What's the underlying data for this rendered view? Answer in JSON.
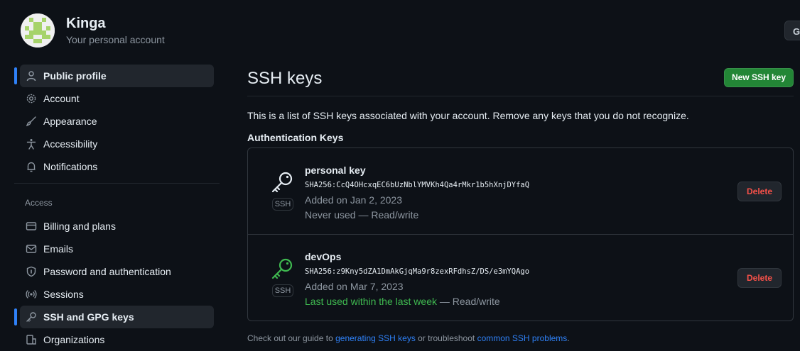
{
  "account": {
    "name": "Kinga",
    "subtitle": "Your personal account",
    "go_button_label": "G"
  },
  "sidebar": {
    "items_top": [
      {
        "label": "Public profile",
        "icon": "person-icon",
        "active": false
      },
      {
        "label": "Account",
        "icon": "gear-icon"
      },
      {
        "label": "Appearance",
        "icon": "paintbrush-icon"
      },
      {
        "label": "Accessibility",
        "icon": "accessibility-icon"
      },
      {
        "label": "Notifications",
        "icon": "bell-icon"
      }
    ],
    "access_heading": "Access",
    "items_access": [
      {
        "label": "Billing and plans",
        "icon": "credit-card-icon"
      },
      {
        "label": "Emails",
        "icon": "mail-icon"
      },
      {
        "label": "Password and authentication",
        "icon": "shield-lock-icon"
      },
      {
        "label": "Sessions",
        "icon": "broadcast-icon"
      },
      {
        "label": "SSH and GPG keys",
        "icon": "key-icon",
        "active": true
      },
      {
        "label": "Organizations",
        "icon": "organization-icon"
      }
    ]
  },
  "main": {
    "title": "SSH keys",
    "new_button": "New SSH key",
    "description": "This is a list of SSH keys associated with your account. Remove any keys that you do not recognize.",
    "auth_heading": "Authentication Keys",
    "keys": [
      {
        "title": "personal key",
        "fingerprint": "SHA256:CcQ4OHcxqEC6bUzNblYMVKh4Qa4rMkr1b5hXnjDYfaQ",
        "added": "Added on Jan 2, 2023",
        "usage": "Never used",
        "access": "— Read/write",
        "badge": "SSH",
        "delete": "Delete",
        "icon_color": "#e6edf3"
      },
      {
        "title": "devOps",
        "fingerprint": "SHA256:z9Kny5dZA1DmAkGjqMa9r8zexRFdhsZ/DS/e3mYQAgo",
        "added": "Added on Mar 7, 2023",
        "usage": "Last used within the last week",
        "access": "— Read/write",
        "badge": "SSH",
        "delete": "Delete",
        "icon_color": "#3fb950"
      }
    ],
    "footer": {
      "prefix": "Check out our guide to",
      "link1": "generating SSH keys",
      "middle": "or troubleshoot",
      "link2": "common SSH problems",
      "suffix": "."
    }
  },
  "colors": {
    "accent": "#2f81f7",
    "success": "#238636",
    "danger": "#f85149",
    "background": "#0d1117"
  }
}
